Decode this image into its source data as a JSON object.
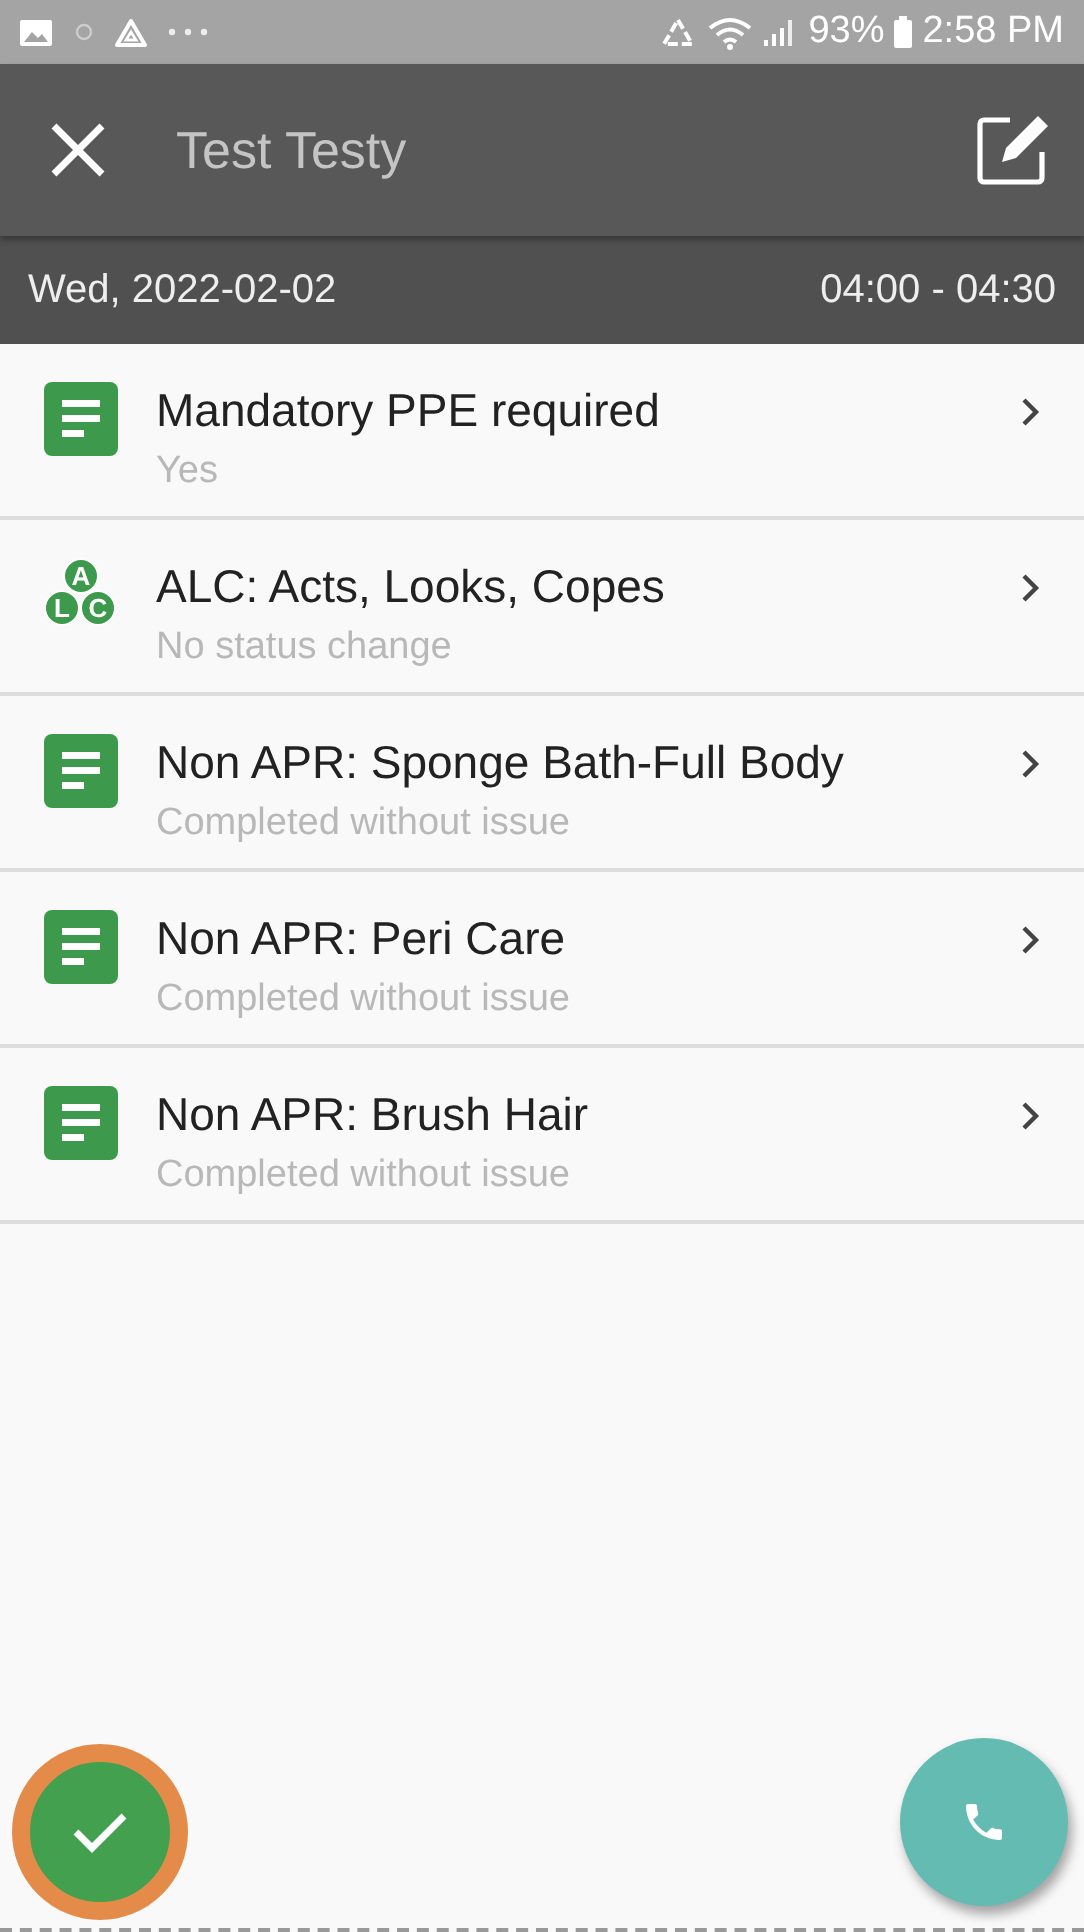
{
  "status_bar": {
    "battery": "93%",
    "time": "2:58 PM"
  },
  "header": {
    "title": "Test Testy"
  },
  "date_bar": {
    "date": "Wed, 2022-02-02",
    "time_range": "04:00 - 04:30"
  },
  "items": [
    {
      "kind": "form",
      "title": "Mandatory PPE required",
      "subtitle": "Yes"
    },
    {
      "kind": "alc",
      "title": "ALC: Acts, Looks, Copes",
      "subtitle": "No status change",
      "icon_letters": [
        "A",
        "L",
        "C"
      ]
    },
    {
      "kind": "form",
      "title": "Non APR: Sponge Bath-Full Body",
      "subtitle": "Completed without issue"
    },
    {
      "kind": "form",
      "title": "Non APR: Peri Care",
      "subtitle": "Completed without issue"
    },
    {
      "kind": "form",
      "title": "Non APR: Brush Hair",
      "subtitle": "Completed without issue"
    }
  ],
  "complete_button": {
    "highlighted": true
  }
}
